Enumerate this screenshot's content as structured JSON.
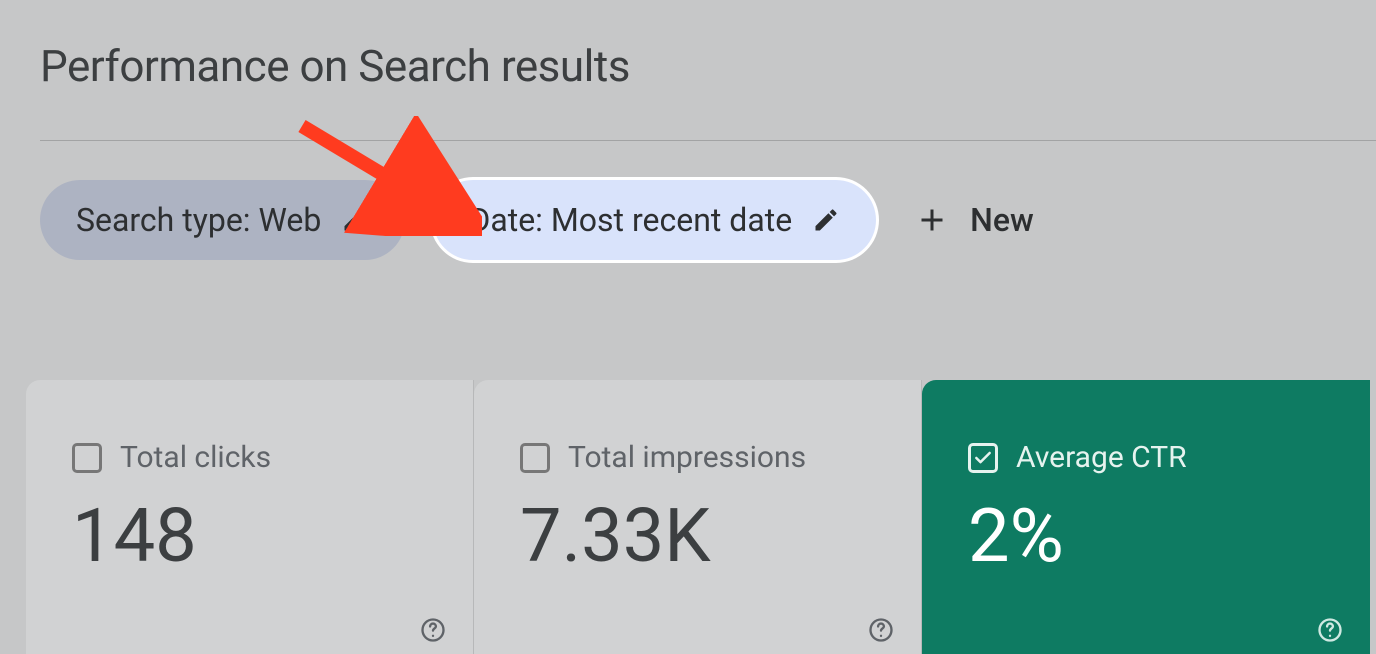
{
  "page_title": "Performance on Search results",
  "filters": {
    "search_type": {
      "label": "Search type: Web"
    },
    "date": {
      "label": "Date: Most recent date"
    },
    "new_button": {
      "label": "New"
    }
  },
  "metrics": {
    "clicks": {
      "label": "Total clicks",
      "value": "148",
      "selected": false
    },
    "impressions": {
      "label": "Total impressions",
      "value": "7.33K",
      "selected": false
    },
    "ctr": {
      "label": "Average CTR",
      "value": "2%",
      "selected": true
    }
  },
  "annotation": {
    "arrow_target": "date-filter-chip",
    "arrow_color": "#ff3b1f"
  }
}
